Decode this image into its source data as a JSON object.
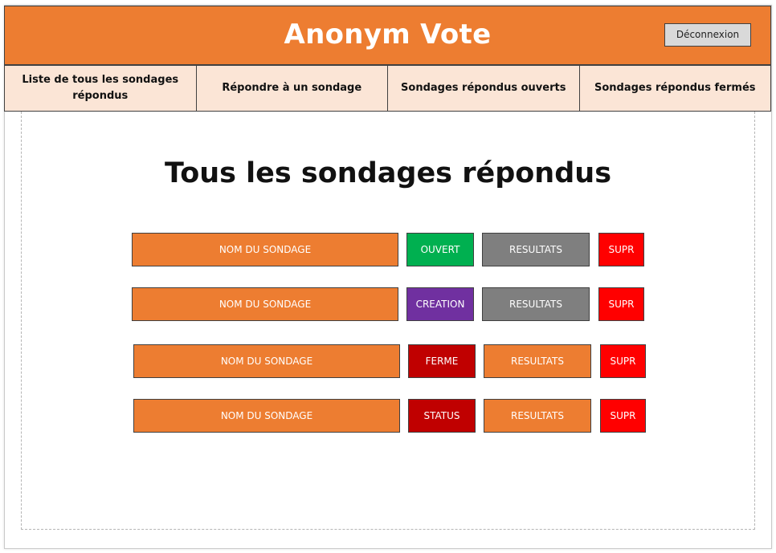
{
  "header": {
    "title": "Anonym Vote",
    "logout_label": "Déconnexion"
  },
  "nav": {
    "items": [
      {
        "label": "Liste de tous les sondages répondus"
      },
      {
        "label": "Répondre à un sondage"
      },
      {
        "label": "Sondages répondus ouverts"
      },
      {
        "label": "Sondages répondus fermés"
      }
    ]
  },
  "main": {
    "title": "Tous les sondages répondus",
    "polls": [
      {
        "name": "NOM DU SONDAGE",
        "status": "OUVERT",
        "status_color": "#00b050",
        "results": "RESULTATS",
        "results_color": "#7f7f7f",
        "delete": "SUPR"
      },
      {
        "name": "NOM DU SONDAGE",
        "status": "CREATION",
        "status_color": "#7030a0",
        "results": "RESULTATS",
        "results_color": "#7f7f7f",
        "delete": "SUPR"
      },
      {
        "name": "NOM DU SONDAGE",
        "status": "FERME",
        "status_color": "#c00000",
        "results": "RESULTATS",
        "results_color": "#ed7d31",
        "delete": "SUPR"
      },
      {
        "name": "NOM DU SONDAGE",
        "status": "STATUS",
        "status_color": "#c00000",
        "results": "RESULTATS",
        "results_color": "#ed7d31",
        "delete": "SUPR"
      }
    ]
  },
  "colors": {
    "accent": "#ed7d31",
    "nav_bg": "#fbe5d6",
    "delete": "#ff0000"
  }
}
